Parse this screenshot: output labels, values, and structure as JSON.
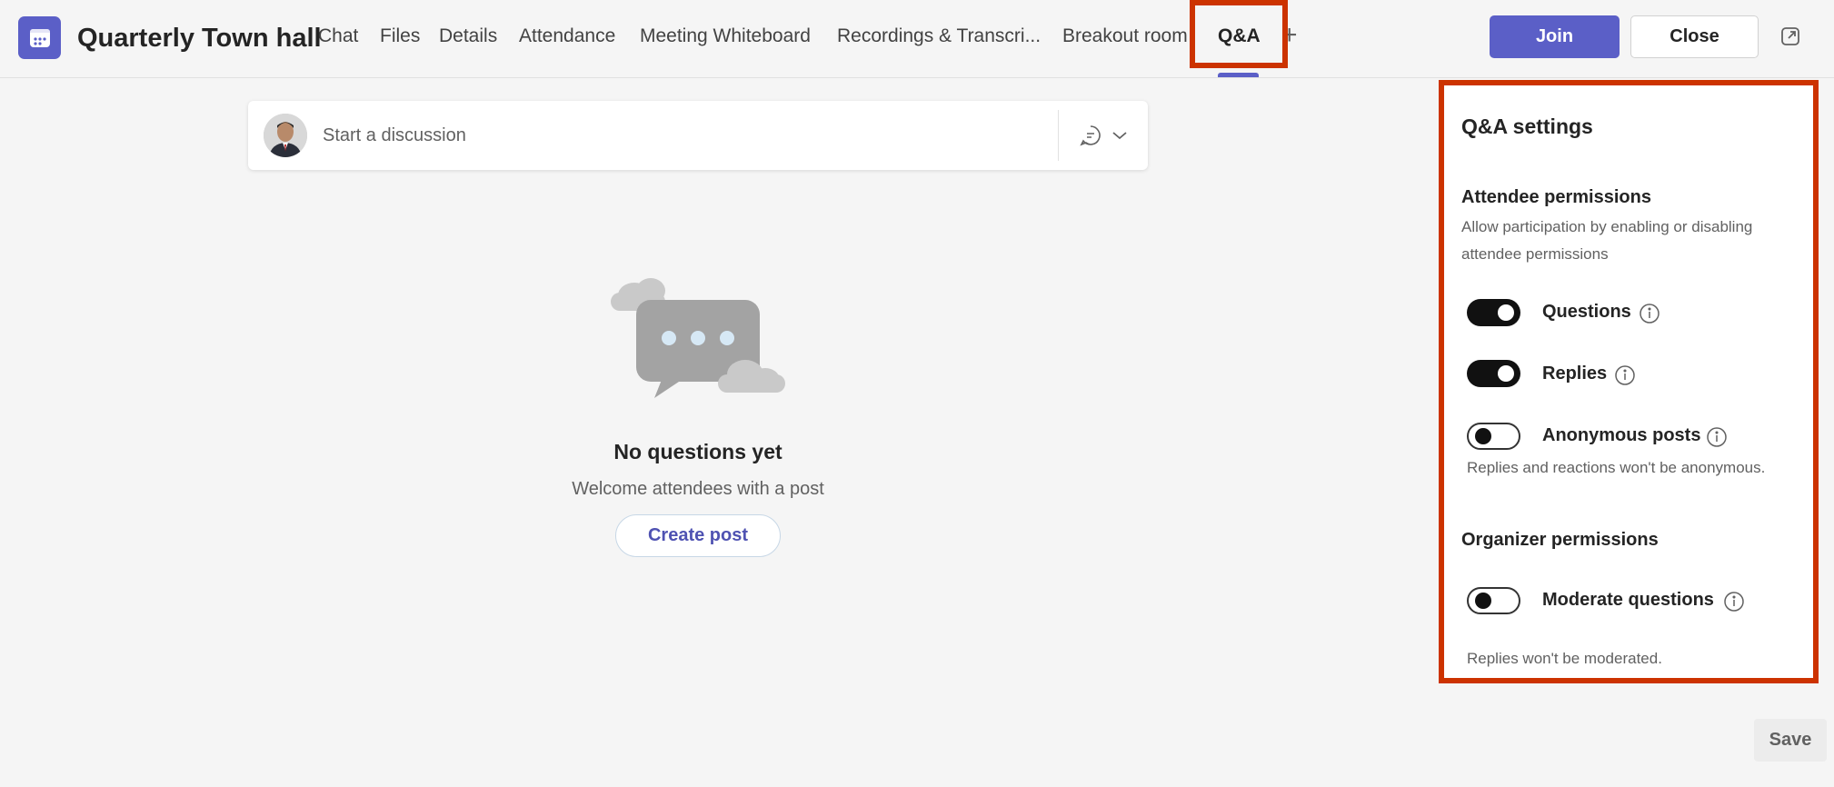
{
  "header": {
    "title": "Quarterly Town hall",
    "tabs": [
      {
        "label": "Chat"
      },
      {
        "label": "Files"
      },
      {
        "label": "Details"
      },
      {
        "label": "Attendance"
      },
      {
        "label": "Meeting Whiteboard"
      },
      {
        "label": "Recordings & Transcri..."
      },
      {
        "label": "Breakout room"
      },
      {
        "label": "Q&A",
        "active": true
      }
    ],
    "add_tab": "+",
    "join_label": "Join",
    "close_label": "Close"
  },
  "discussion": {
    "placeholder": "Start a discussion"
  },
  "empty_state": {
    "title": "No questions yet",
    "subtitle": "Welcome attendees with a post",
    "create_label": "Create post"
  },
  "settings": {
    "title": "Q&A settings",
    "attendee": {
      "title": "Attendee permissions",
      "description": "Allow participation by enabling or disabling attendee permissions",
      "toggles": [
        {
          "label": "Questions",
          "on": true
        },
        {
          "label": "Replies",
          "on": true
        },
        {
          "label": "Anonymous posts",
          "on": false
        }
      ],
      "anonymous_note": "Replies and reactions won't be anonymous."
    },
    "organizer": {
      "title": "Organizer permissions",
      "toggles": [
        {
          "label": "Moderate questions",
          "on": false
        }
      ],
      "moderate_note": "Replies won't be moderated."
    }
  },
  "footer": {
    "save_label": "Save"
  },
  "colors": {
    "accent": "#5b5fc7",
    "highlight": "#cc3300"
  }
}
